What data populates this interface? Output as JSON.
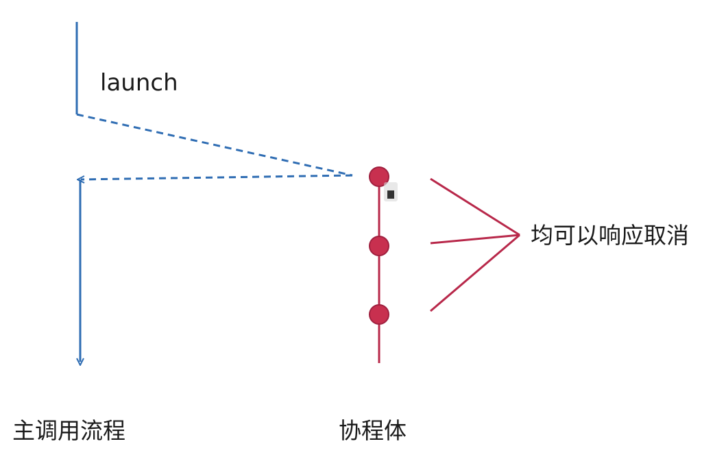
{
  "diagram": {
    "launch_label": "launch",
    "main_flow_label": "主调用流程",
    "coroutine_label": "协程体",
    "cancel_label": "均可以响应取消",
    "suspend_point_count": 3,
    "colors": {
      "main_flow": "#2f6db3",
      "coroutine": "#b8284a",
      "text": "#1a1a1a"
    }
  }
}
